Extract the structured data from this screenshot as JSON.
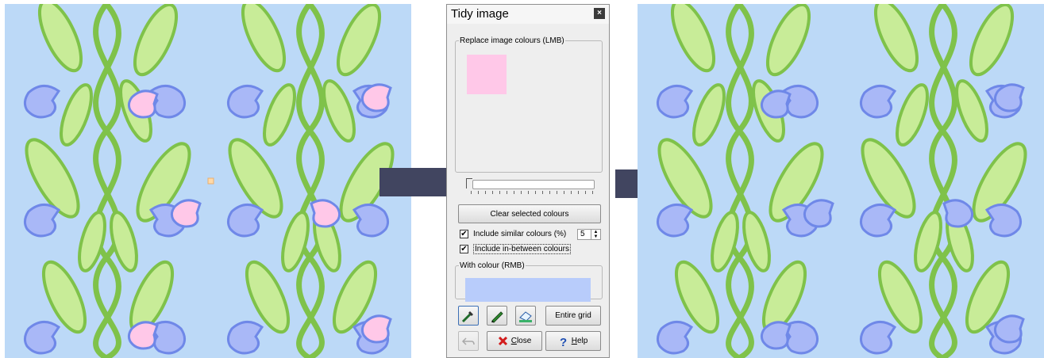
{
  "dialog": {
    "title": "Tidy image",
    "close_symbol": "×",
    "replace_group_label": "Replace image colours (LMB)",
    "replace_colour": "#ffc8e8",
    "slider_value": 0,
    "clear_button": "Clear selected colours",
    "include_similar": {
      "label": "Include similar colours (%)",
      "checked": true,
      "check_mark": "✔"
    },
    "similar_value": "5",
    "spin_up": "▲",
    "spin_down": "▼",
    "include_between": {
      "label": "Include in-between colours",
      "checked": true,
      "check_mark": "✔"
    },
    "with_group_label": "With colour (RMB)",
    "with_colour": "#b8ccfb",
    "entire_grid_button": "Entire grid",
    "close_button": {
      "mnemonic": "C",
      "rest": "lose"
    },
    "help_button": {
      "mnemonic": "H",
      "rest": "elp"
    },
    "tools": [
      "colour-picker-icon",
      "pen-icon",
      "eraser-icon",
      "undo-icon"
    ]
  },
  "images": {
    "background": "#bcd9f7",
    "leaf_colour": "#c8ec98",
    "stem_colour": "#7fc24a",
    "flower_colour": "#a9b8f7",
    "flower_outline": "#6f88e8",
    "pink_colour": "#ffc8e8"
  },
  "arrows": {
    "colour": "#414560"
  }
}
